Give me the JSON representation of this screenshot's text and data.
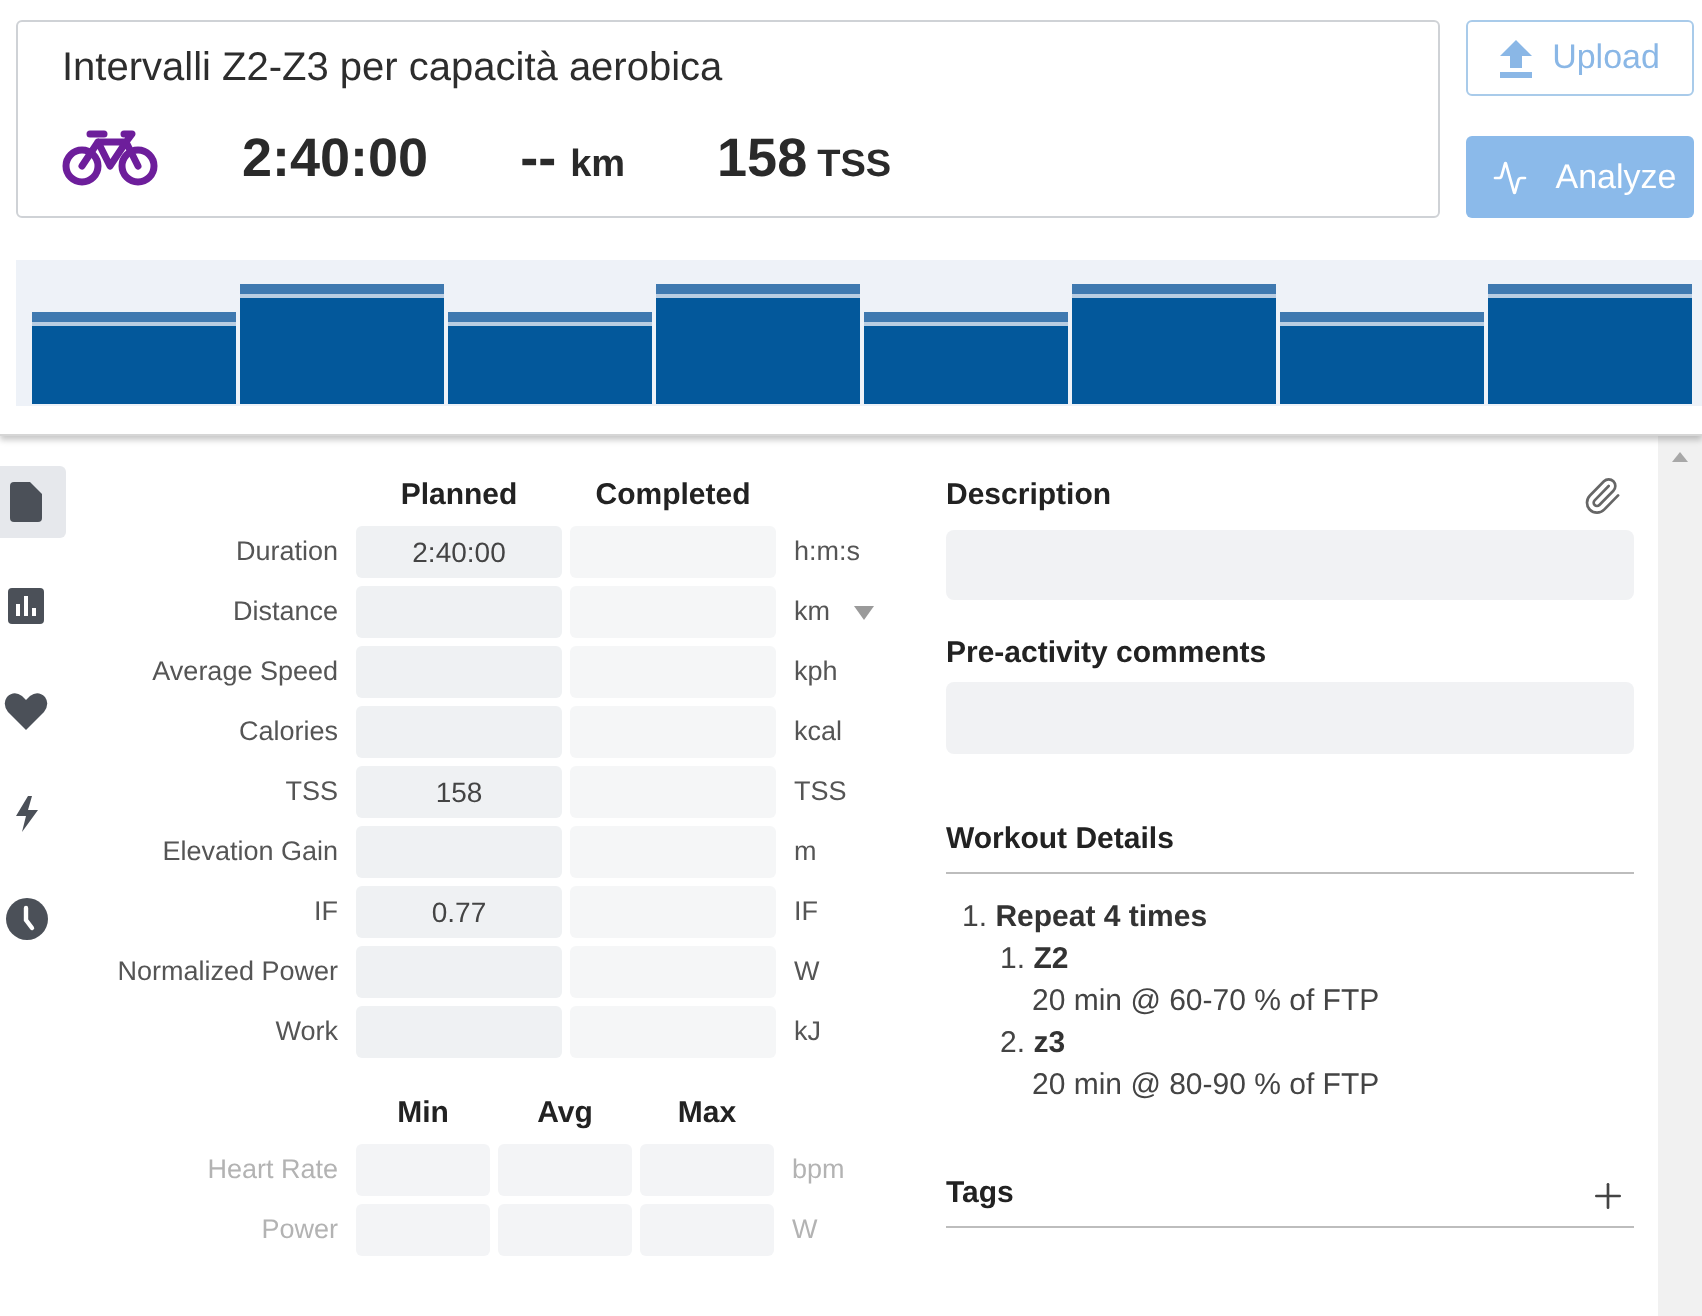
{
  "workout": {
    "title": "Intervalli Z2-Z3 per capacità aerobica",
    "duration": "2:40:00",
    "distance": "--",
    "distance_unit": "km",
    "tss": "158",
    "tss_unit": "TSS"
  },
  "actions": [
    {
      "label": "Upload",
      "kind": "upload",
      "disabled": true
    },
    {
      "label": "Analyze",
      "kind": "analyze",
      "disabled": true
    }
  ],
  "side_tabs": [
    {
      "kind": "summary",
      "selected": true
    },
    {
      "kind": "stats",
      "selected": false
    },
    {
      "kind": "heart",
      "selected": false
    },
    {
      "kind": "power",
      "selected": false
    },
    {
      "kind": "time",
      "selected": false
    }
  ],
  "metrics": {
    "columns": [
      "Planned",
      "Completed"
    ],
    "rows": [
      {
        "label": "Duration",
        "planned": "2:40:00",
        "unit": "h:m:s",
        "unit_menu": false
      },
      {
        "label": "Distance",
        "unit": "km",
        "unit_menu": true
      },
      {
        "label": "Average Speed",
        "unit": "kph",
        "unit_menu": false
      },
      {
        "label": "Calories",
        "unit": "kcal",
        "unit_menu": false
      },
      {
        "label": "TSS",
        "planned": "158",
        "unit": "TSS",
        "unit_menu": false
      },
      {
        "label": "Elevation Gain",
        "unit": "m",
        "unit_menu": false
      },
      {
        "label": "IF",
        "planned": "0.77",
        "unit": "IF",
        "unit_menu": false
      },
      {
        "label": "Normalized Power",
        "unit": "W",
        "unit_menu": false
      },
      {
        "label": "Work",
        "unit": "kJ",
        "unit_menu": false
      }
    ]
  },
  "ranges": {
    "columns": [
      "Min",
      "Avg",
      "Max"
    ],
    "rows": [
      {
        "label": "Heart Rate",
        "disabled": true,
        "unit": "bpm"
      },
      {
        "label": "Power",
        "disabled": true,
        "unit": "W"
      }
    ]
  },
  "description": {
    "label": "Description"
  },
  "comments": {
    "label": "Pre-activity comments"
  },
  "workout_details": {
    "title": "Workout Details",
    "steps": [
      {
        "number": "1.",
        "name": "Repeat 4 times",
        "children": [
          {
            "number": "1.",
            "name": "Z2",
            "detail": "20 min @ 60-70 % of FTP"
          },
          {
            "number": "2.",
            "name": "z3",
            "detail": "20 min @ 80-90 % of FTP"
          }
        ]
      }
    ]
  },
  "tags": {
    "label": "Tags"
  }
}
